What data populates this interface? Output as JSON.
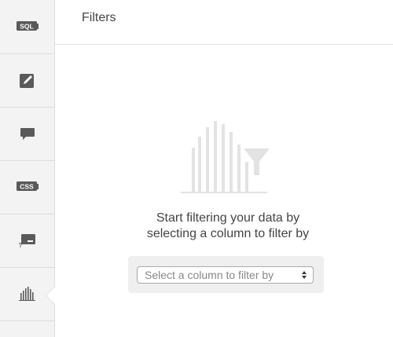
{
  "header": {
    "title": "Filters"
  },
  "sidebar": {
    "items": [
      {
        "name": "sql",
        "label": "SQL",
        "icon": "sql-icon"
      },
      {
        "name": "edit",
        "icon": "pencil-icon"
      },
      {
        "name": "comment",
        "icon": "comment-icon"
      },
      {
        "name": "css",
        "label": "CSS",
        "icon": "css-icon"
      },
      {
        "name": "help-panel",
        "label": "?",
        "icon": "help-panel-icon"
      },
      {
        "name": "filters",
        "icon": "bar-chart-icon",
        "active": true
      }
    ]
  },
  "main": {
    "empty_state": {
      "line1": "Start filtering your data by",
      "line2": "selecting a column to filter by"
    },
    "column_select": {
      "placeholder": "Select a column to filter by"
    }
  },
  "colors": {
    "icon": "#5a5a5a",
    "sidebar_bg": "#f3f3f3",
    "illustration": "#e3e3e3"
  }
}
